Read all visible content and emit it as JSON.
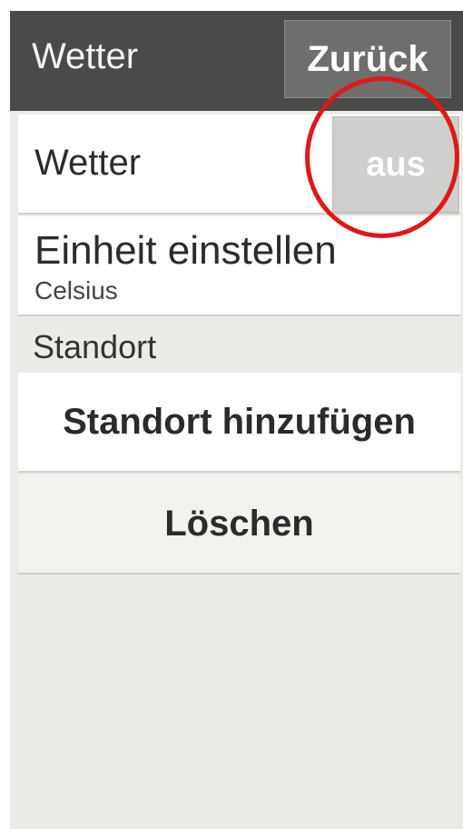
{
  "header": {
    "title": "Wetter",
    "back_label": "Zurück"
  },
  "settings": {
    "weather_label": "Wetter",
    "weather_toggle": "aus",
    "unit_label": "Einheit einstellen",
    "unit_value": "Celsius"
  },
  "location": {
    "section_label": "Standort",
    "add_label": "Standort hinzufügen",
    "delete_label": "Löschen"
  },
  "colors": {
    "header_bg": "#4a4a48",
    "background": "#ebebe8",
    "toggle_off": "#cfcfcd",
    "highlight": "#e01818"
  }
}
